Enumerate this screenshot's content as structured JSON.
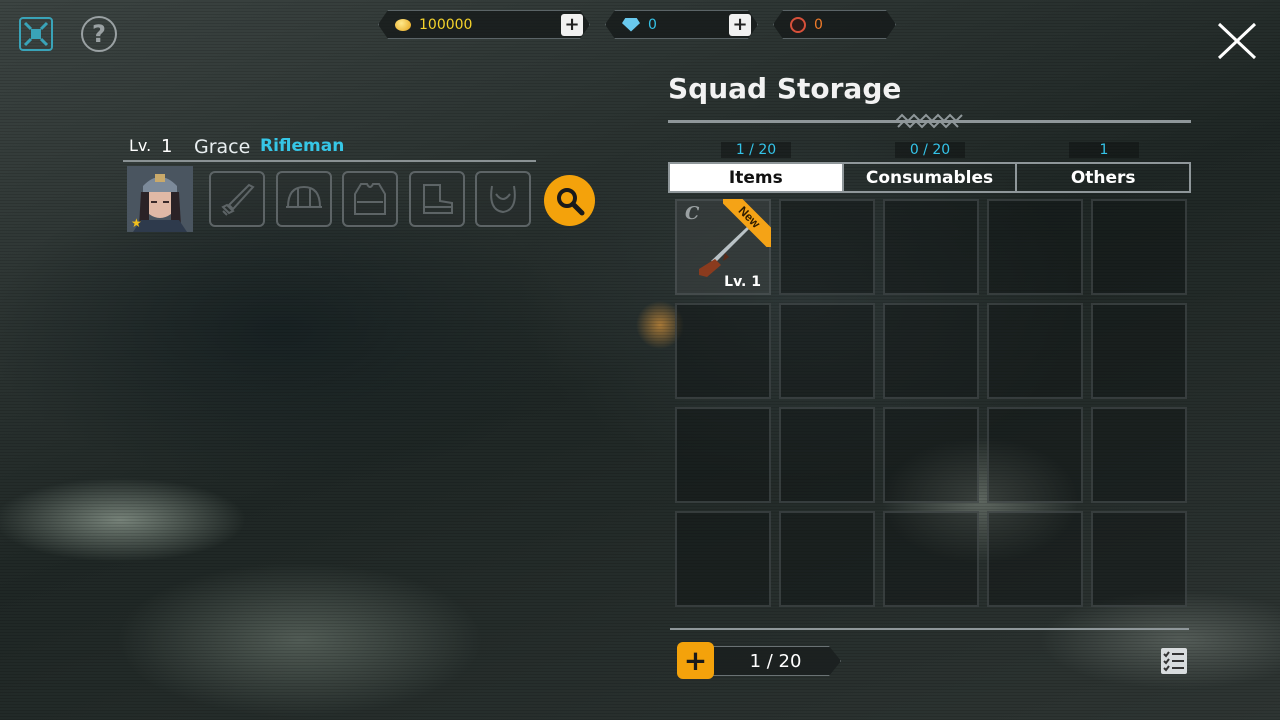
{
  "currency": {
    "gold": "100000",
    "gems": "0",
    "tickets": "0",
    "gold_color": "#f4d22b",
    "gem_color": "#34c3e8",
    "ticket_color": "#f07b2a"
  },
  "character": {
    "level_label": "Lv.",
    "level": "1",
    "name": "Grace",
    "class": "Rifleman"
  },
  "storage": {
    "title": "Squad Storage",
    "tabs": [
      {
        "label": "Items",
        "count": "1 / 20",
        "active": true
      },
      {
        "label": "Consumables",
        "count": "0 / 20",
        "active": false
      },
      {
        "label": "Others",
        "count": "1",
        "active": false
      }
    ],
    "items": [
      {
        "grade": "C",
        "badge": "New",
        "level": "Lv. 1",
        "icon": "rifle-icon"
      }
    ],
    "capacity": "1 / 20"
  },
  "colors": {
    "accent": "#f4a20b",
    "cyan": "#34c3e8"
  }
}
